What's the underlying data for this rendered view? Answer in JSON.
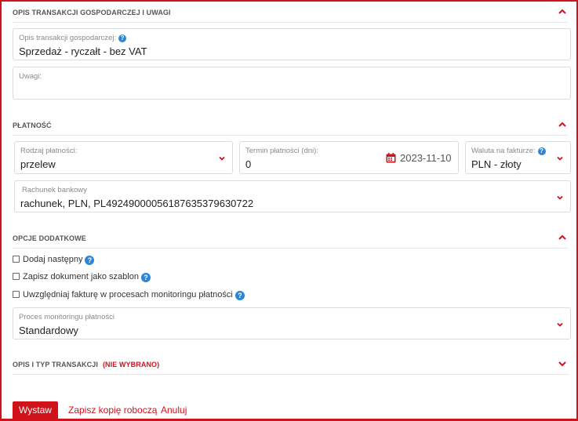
{
  "sections": {
    "opis": {
      "title": "OPIS TRANSAKCJI GOSPODARCZEJ I UWAGI"
    },
    "platnosc": {
      "title": "PŁATNOŚĆ"
    },
    "opcje": {
      "title": "OPCJE DODATKOWE"
    },
    "typ": {
      "title": "OPIS I TYP TRANSAKCJI",
      "status": "(NIE WYBRANO)"
    }
  },
  "fields": {
    "opis_transakcji": {
      "label": "Opis transakcji gospodarczej:",
      "value": "Sprzedaż - ryczałt - bez VAT"
    },
    "uwagi": {
      "label": "Uwagi:",
      "value": ""
    },
    "rodzaj_platnosci": {
      "label": "Rodzaj płatności:",
      "value": "przelew"
    },
    "termin_platnosci": {
      "label": "Termin płatności (dni):",
      "value": "0",
      "date": "2023-11-10"
    },
    "waluta": {
      "label": "Waluta na fakturze:",
      "value": "PLN - złoty"
    },
    "rachunek": {
      "label": "Rachunek bankowy",
      "value": "rachunek, PLN, PL49249000056187635379630722"
    },
    "proces_monitoringu": {
      "label": "Proces monitoringu płatności",
      "value": "Standardowy"
    }
  },
  "checkboxes": [
    {
      "label": "Dodaj następny",
      "checked": false
    },
    {
      "label": "Zapisz dokument jako szablon",
      "checked": false
    },
    {
      "label": "Uwzględniaj fakturę w procesach monitoringu płatności",
      "checked": false
    }
  ],
  "icons": {
    "help": "?",
    "chevron": "chevron-icon",
    "calendar": "calendar-icon"
  },
  "buttons": {
    "issue": "Wystaw",
    "save_draft": "Zapisz kopię roboczą",
    "cancel": "Anuluj"
  },
  "colors": {
    "accent": "#d0121b",
    "help": "#2b86d6"
  }
}
